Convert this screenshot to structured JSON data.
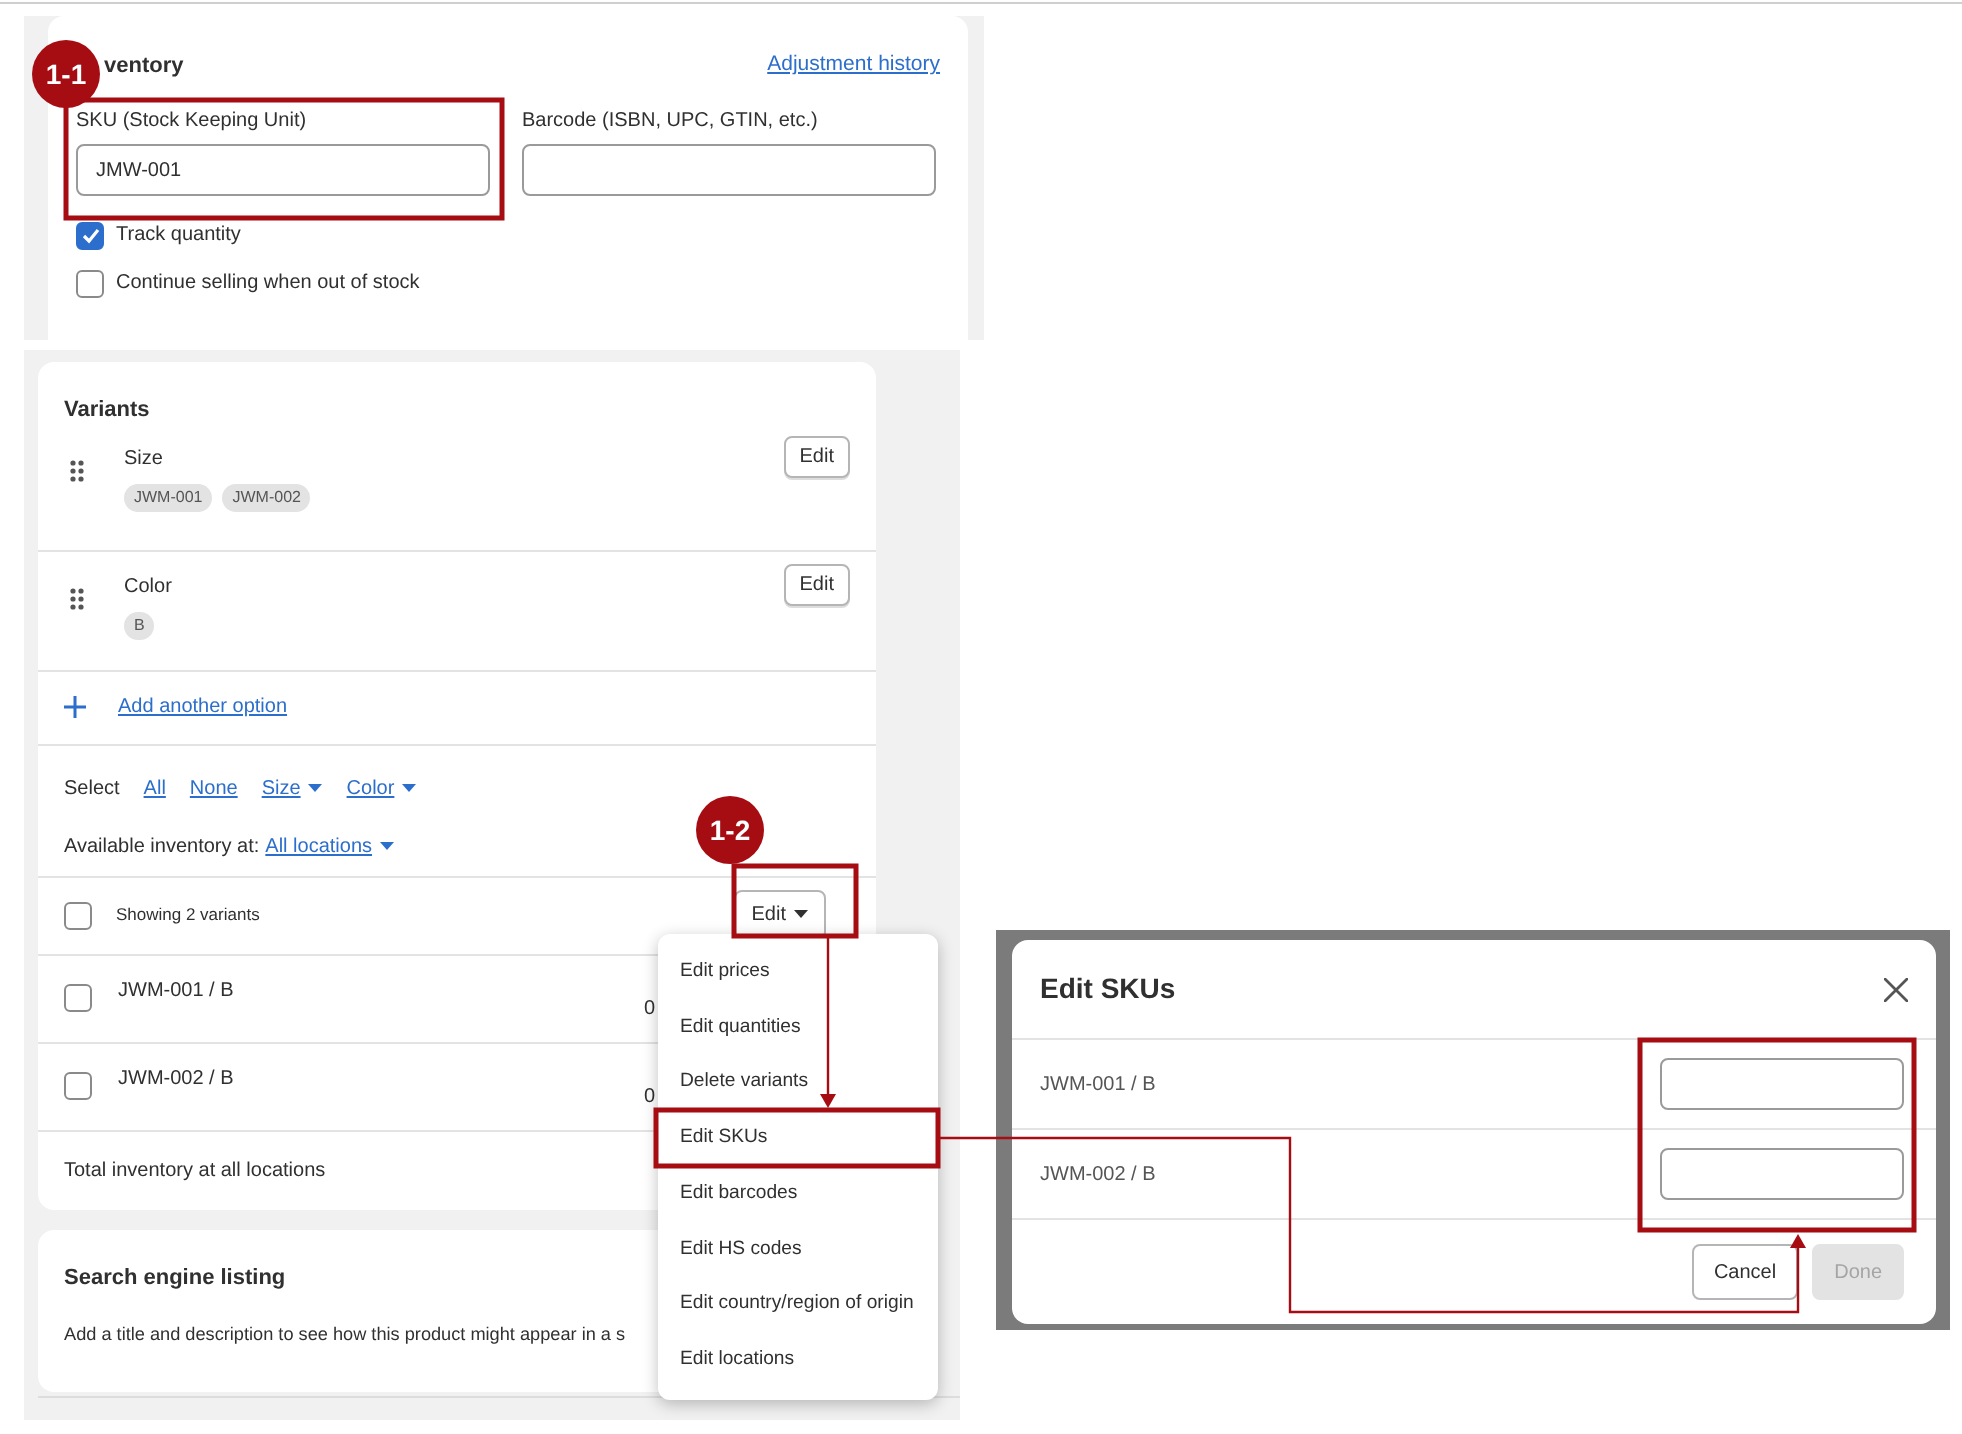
{
  "inventory": {
    "heading": "ventory",
    "link": "Adjustment history",
    "fields": [
      {
        "label": "SKU (Stock Keeping Unit)",
        "value": "JMW-001"
      },
      {
        "label": "Barcode (ISBN, UPC, GTIN, etc.)"
      }
    ],
    "checkboxes": [
      {
        "label": "Track quantity",
        "checked": true
      },
      {
        "label": "Continue selling when out of stock",
        "checked": false
      }
    ]
  },
  "variants": {
    "heading": "Variants",
    "options": [
      {
        "name": "Size",
        "values": [
          "JWM-001",
          "JWM-002"
        ],
        "button": "Edit"
      },
      {
        "name": "Color",
        "values": [
          "B"
        ],
        "button": "Edit"
      }
    ],
    "add_option": "Add another option",
    "select_label": "Select",
    "select_links": [
      {
        "label": "All",
        "dropdown": false
      },
      {
        "label": "None",
        "dropdown": false
      },
      {
        "label": "Size",
        "dropdown": true
      },
      {
        "label": "Color",
        "dropdown": true
      }
    ],
    "inventory_label": "Available inventory at:",
    "inventory_link": "All locations",
    "bulk": {
      "checked": false,
      "label": "Showing 2 variants",
      "button": "Edit"
    },
    "rows": [
      {
        "name": "JWM-001 / B",
        "checked": false,
        "column_2": "0"
      },
      {
        "name": "JWM-002 / B",
        "checked": false,
        "column_2": "0"
      }
    ],
    "total": "Total inventory at all locations"
  },
  "search_listing": {
    "heading": "Search engine listing",
    "text": "Add a title and description to see how this product might appear in a s"
  },
  "menu": {
    "items": [
      "Edit prices",
      "Edit quantities",
      "Delete variants",
      "Edit SKUs",
      "Edit barcodes",
      "Edit HS codes",
      "Edit country/region of origin",
      "Edit locations"
    ]
  },
  "dialog": {
    "title": "Edit SKUs",
    "rows": [
      {
        "label": "JWM-001 / B"
      },
      {
        "label": "JWM-002 / B"
      }
    ],
    "buttons": [
      {
        "label": "Cancel",
        "disabled": false
      },
      {
        "label": "Done",
        "disabled": true
      }
    ]
  },
  "annotations": [
    {
      "label": "1-1"
    },
    {
      "label": "1-2"
    }
  ]
}
